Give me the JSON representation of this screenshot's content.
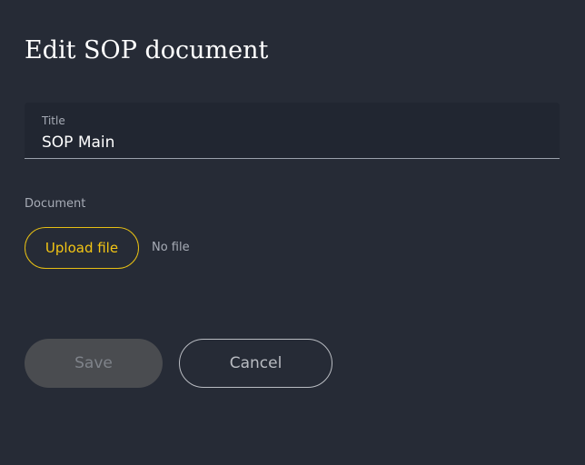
{
  "dialog": {
    "title": "Edit SOP document"
  },
  "title_field": {
    "label": "Title",
    "value": "SOP Main"
  },
  "document_field": {
    "label": "Document",
    "upload_label": "Upload file",
    "file_status": "No file"
  },
  "actions": {
    "save_label": "Save",
    "save_enabled": false,
    "cancel_label": "Cancel"
  },
  "colors": {
    "background": "#262b36",
    "field_background": "#212631",
    "accent": "#f3c514",
    "text_primary": "#ffffff",
    "text_secondary": "#a7acb6",
    "disabled_button": "#4a4c50"
  }
}
